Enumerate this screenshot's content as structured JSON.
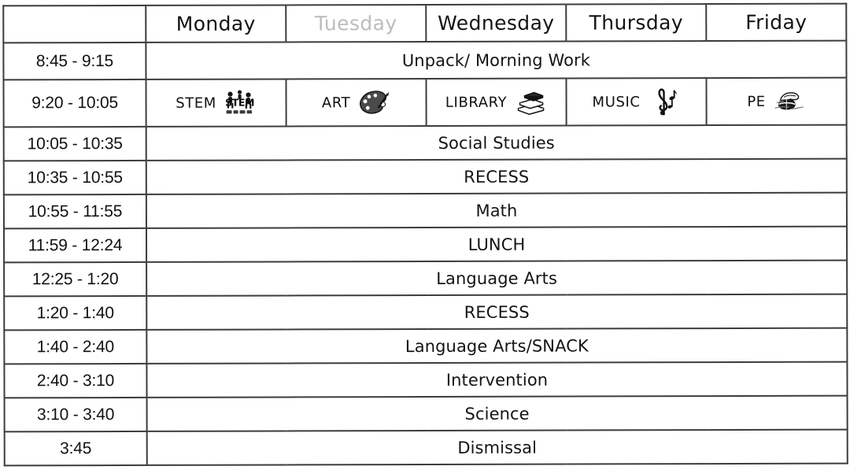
{
  "table": {
    "corner_label": "",
    "day_headers": [
      {
        "label": "Monday",
        "faded": false
      },
      {
        "label": "Tuesday",
        "faded": true
      },
      {
        "label": "Wednesday",
        "faded": false
      },
      {
        "label": "Thursday",
        "faded": false
      },
      {
        "label": "Friday",
        "faded": false
      }
    ],
    "rows": [
      {
        "time": "8:45 - 9:15",
        "kind": "full",
        "activity": "Unpack/ Morning Work"
      },
      {
        "time": "9:20 - 10:05",
        "kind": "specials",
        "specials": [
          {
            "label": "STEM",
            "icon": "stem-clipart-icon"
          },
          {
            "label": "ART",
            "icon": "paint-palette-icon"
          },
          {
            "label": "LIBRARY",
            "icon": "stack-of-books-icon"
          },
          {
            "label": "MUSIC",
            "icon": "treble-clef-icon"
          },
          {
            "label": "PE",
            "icon": "sports-ball-icon"
          }
        ]
      },
      {
        "time": "10:05 - 10:35",
        "kind": "full",
        "activity": "Social Studies"
      },
      {
        "time": "10:35 - 10:55",
        "kind": "full",
        "activity": "RECESS"
      },
      {
        "time": "10:55 - 11:55",
        "kind": "full",
        "activity": "Math"
      },
      {
        "time": "11:59 - 12:24",
        "kind": "full",
        "activity": "LUNCH"
      },
      {
        "time": "12:25 - 1:20",
        "kind": "full",
        "activity": "Language Arts"
      },
      {
        "time": "1:20 - 1:40",
        "kind": "full",
        "activity": "RECESS"
      },
      {
        "time": "1:40 - 2:40",
        "kind": "full",
        "activity": "Language Arts/SNACK"
      },
      {
        "time": "2:40 - 3:10",
        "kind": "full",
        "activity": "Intervention"
      },
      {
        "time": "3:10 - 3:40",
        "kind": "full",
        "activity": "Science"
      },
      {
        "time": "3:45",
        "kind": "full",
        "activity": "Dismissal"
      }
    ]
  },
  "colors": {
    "border": "#3c3c3c",
    "text": "#141414",
    "faded_header_text": "#bdbdbd",
    "background": "#ffffff"
  }
}
